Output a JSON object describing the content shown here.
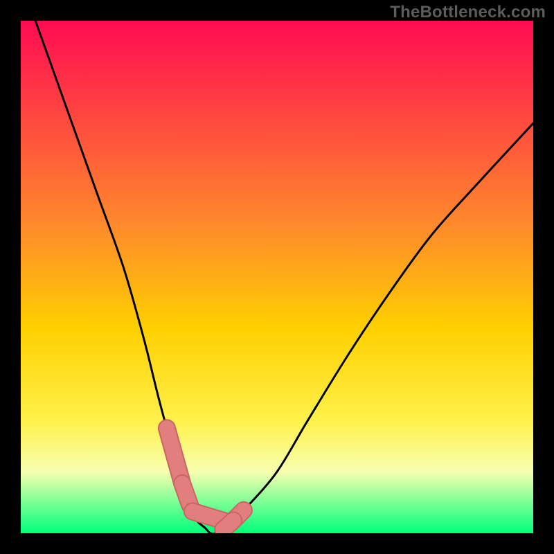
{
  "watermark": "TheBottleneck.com",
  "colors": {
    "frame": "#000000",
    "watermark": "#5c5c5c",
    "gradient_top": "#ff0c52",
    "gradient_mid": "#ffd000",
    "gradient_yellow": "#fff14a",
    "gradient_pale": "#f7ffb0",
    "gradient_bottom": "#00ff7a",
    "curve": "#000000",
    "marker_fill": "#e07f7d",
    "marker_stroke": "#c86663"
  },
  "chart_data": {
    "type": "line",
    "title": "",
    "xlabel": "",
    "ylabel": "",
    "xlim": [
      0,
      100
    ],
    "ylim": [
      0,
      100
    ],
    "series": [
      {
        "name": "bottleneck-curve",
        "x": [
          0,
          5,
          10,
          15,
          20,
          24,
          27,
          30,
          32,
          34,
          36,
          37,
          38,
          40,
          44,
          50,
          56,
          64,
          72,
          80,
          88,
          100
        ],
        "values": [
          108,
          94,
          80,
          66,
          52,
          38,
          26,
          15,
          8,
          3,
          1,
          0,
          0,
          1,
          5,
          12,
          22,
          35,
          47,
          58,
          67,
          80
        ]
      }
    ],
    "markers": [
      {
        "x_range": [
          28.5,
          31.5
        ],
        "y_approx": 18,
        "type": "pill"
      },
      {
        "x_range": [
          31.5,
          33.0
        ],
        "y_approx": 9,
        "type": "pill"
      },
      {
        "x_range": [
          33.5,
          41.0
        ],
        "y_approx": 0.5,
        "type": "pill"
      },
      {
        "x_range": [
          41.0,
          43.5
        ],
        "y_approx": 4,
        "type": "pill"
      },
      {
        "x_range": [
          39.5,
          41.5
        ],
        "y_approx": 15,
        "type": "pill"
      }
    ],
    "gradient_stops": [
      {
        "offset": 0.0,
        "color": "#ff0c52"
      },
      {
        "offset": 0.4,
        "color": "#ff8a2b"
      },
      {
        "offset": 0.6,
        "color": "#ffd000"
      },
      {
        "offset": 0.78,
        "color": "#fff14a"
      },
      {
        "offset": 0.88,
        "color": "#f7ffb0"
      },
      {
        "offset": 1.0,
        "color": "#00ff7a"
      }
    ]
  }
}
